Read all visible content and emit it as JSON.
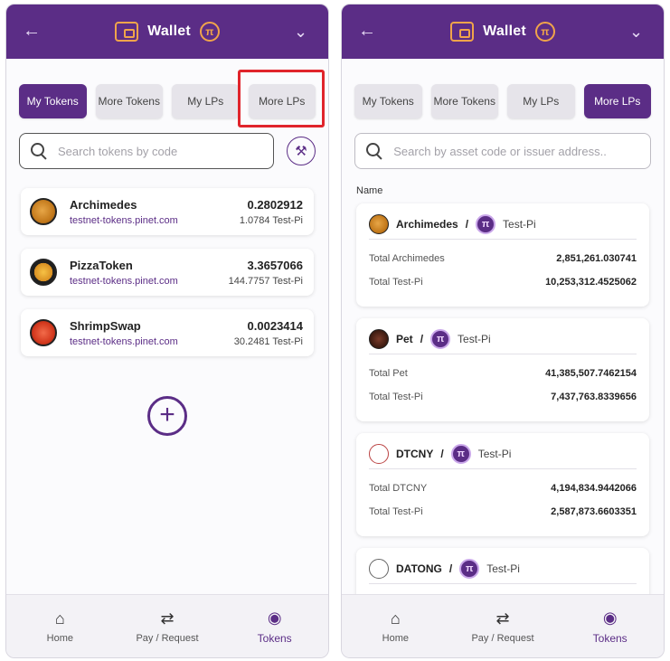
{
  "left": {
    "header": {
      "title": "Wallet",
      "pi_symbol": "π"
    },
    "tabs": [
      "My Tokens",
      "More Tokens",
      "My LPs",
      "More LPs"
    ],
    "active_tab": "My Tokens",
    "highlighted_tab": "More LPs",
    "search": {
      "placeholder": "Search tokens by code"
    },
    "tokens": [
      {
        "name": "Archimedes",
        "domain": "testnet-tokens.pinet.com",
        "balance": "0.2802912",
        "pi_value": "1.0784 Test-Pi",
        "logo": "archimedes-logo"
      },
      {
        "name": "PizzaToken",
        "domain": "testnet-tokens.pinet.com",
        "balance": "3.3657066",
        "pi_value": "144.7757 Test-Pi",
        "logo": "pizza-logo"
      },
      {
        "name": "ShrimpSwap",
        "domain": "testnet-tokens.pinet.com",
        "balance": "0.0023414",
        "pi_value": "30.2481 Test-Pi",
        "logo": "shrimp-logo"
      }
    ],
    "add_symbol": "+",
    "nav": [
      {
        "label": "Home",
        "icon": "home-icon"
      },
      {
        "label": "Pay / Request",
        "icon": "swap-arrows-icon"
      },
      {
        "label": "Tokens",
        "icon": "money-bag-icon"
      }
    ]
  },
  "right": {
    "header": {
      "title": "Wallet",
      "pi_symbol": "π"
    },
    "tabs": [
      "My Tokens",
      "More Tokens",
      "My LPs",
      "More LPs"
    ],
    "active_tab": "More LPs",
    "search": {
      "placeholder": "Search by asset code or issuer address.."
    },
    "column_label": "Name",
    "pools": [
      {
        "asset": "Archimedes",
        "sep": "/",
        "pair": "Test-Pi",
        "rows": [
          {
            "k": "Total Archimedes",
            "v": "2,851,261.030741"
          },
          {
            "k": "Total Test-Pi",
            "v": "10,253,312.4525062"
          }
        ]
      },
      {
        "asset": "Pet",
        "sep": "/",
        "pair": "Test-Pi",
        "rows": [
          {
            "k": "Total Pet",
            "v": "41,385,507.7462154"
          },
          {
            "k": "Total Test-Pi",
            "v": "7,437,763.8339656"
          }
        ]
      },
      {
        "asset": "DTCNY",
        "sep": "/",
        "pair": "Test-Pi",
        "rows": [
          {
            "k": "Total DTCNY",
            "v": "4,194,834.9442066"
          },
          {
            "k": "Total Test-Pi",
            "v": "2,587,873.6603351"
          }
        ]
      },
      {
        "asset": "DATONG",
        "sep": "/",
        "pair": "Test-Pi",
        "rows": []
      }
    ],
    "nav": [
      {
        "label": "Home",
        "icon": "home-icon"
      },
      {
        "label": "Pay / Request",
        "icon": "swap-arrows-icon"
      },
      {
        "label": "Tokens",
        "icon": "money-bag-icon"
      }
    ]
  },
  "colors": {
    "brand_purple": "#5b2d86",
    "accent_orange": "#f0a44a",
    "highlight_red": "#e0242b"
  }
}
